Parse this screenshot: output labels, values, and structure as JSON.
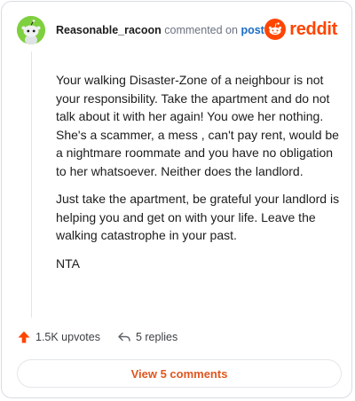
{
  "comment": {
    "username": "Reasonable_racoon",
    "action_text": "commented on",
    "post_link": "post",
    "brand": "reddit",
    "paragraphs": [
      "Your walking Disaster-Zone of a neighbour is not your responsibility. Take the apartment and do not talk about it with her again! You owe her nothing. She's a scammer, a mess , can't pay rent, would be a nightmare roommate and you have no obligation to her whatsoever. Neither does the landlord.",
      "Just take the apartment, be grateful your landlord is helping you and get on with your life. Leave the walking catastrophe in your past.",
      "NTA"
    ],
    "upvotes": "1.5K upvotes",
    "replies": "5 replies",
    "view_comments": "View 5 comments"
  },
  "icons": {
    "avatar": "snoo-avatar-icon",
    "logo": "reddit-alien-icon",
    "upvote": "upvote-arrow-icon",
    "reply": "reply-arrow-icon"
  },
  "colors": {
    "brand": "#ff4500",
    "avatar_bg": "#7fd03e",
    "link": "#1a6cc4",
    "view_button_text": "#e0561f"
  }
}
